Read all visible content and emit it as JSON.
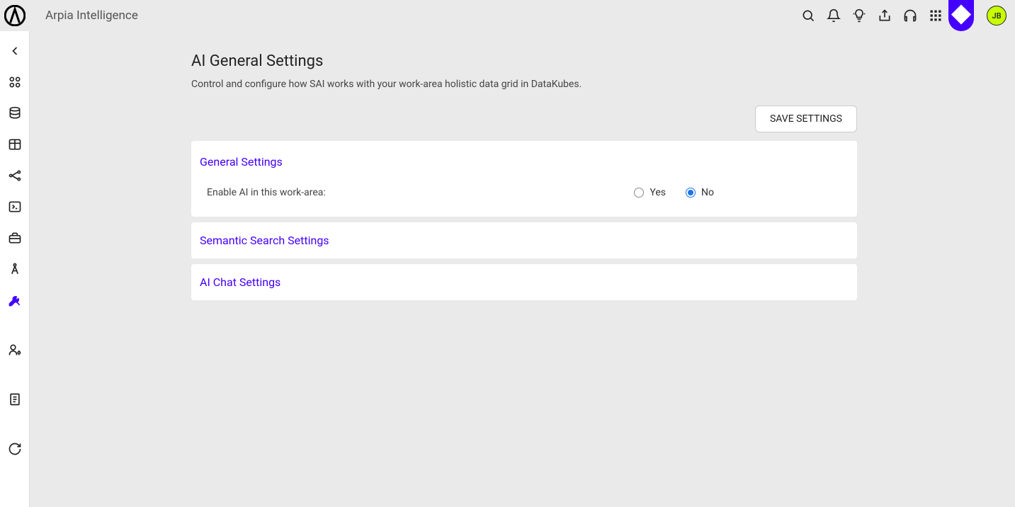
{
  "header": {
    "app_title": "Arpia Intelligence",
    "avatar": "JB"
  },
  "page": {
    "title": "AI General Settings",
    "subtitle": "Control and configure how SAI works with your work-area holistic data grid in DataKubes.",
    "save_button": "SAVE SETTINGS"
  },
  "panels": {
    "general": {
      "title": "General Settings",
      "enable_label": "Enable AI in this work-area:",
      "yes": "Yes",
      "no": "No"
    },
    "semantic": {
      "title": "Semantic Search Settings"
    },
    "chat": {
      "title": "AI Chat Settings"
    }
  }
}
